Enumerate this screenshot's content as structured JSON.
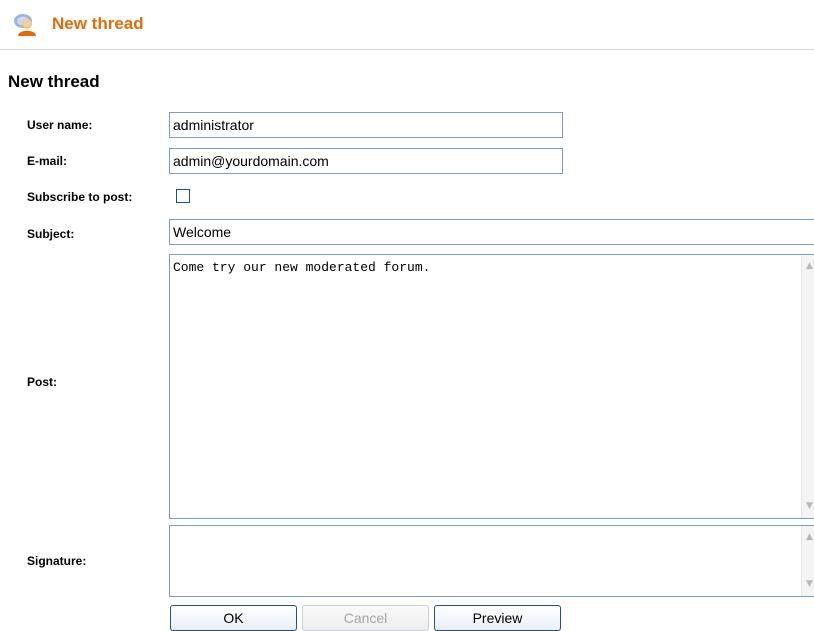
{
  "header": {
    "title": "New thread",
    "icon": "forum-user-icon"
  },
  "form": {
    "heading": "New thread",
    "fields": {
      "username": {
        "label": "User name:",
        "value": "administrator"
      },
      "email": {
        "label": "E-mail:",
        "value": "admin@yourdomain.com"
      },
      "subscribe": {
        "label": "Subscribe to post:",
        "checked": false
      },
      "subject": {
        "label": "Subject:",
        "value": "Welcome"
      },
      "post": {
        "label": "Post:",
        "value": "Come try our new moderated forum."
      },
      "signature": {
        "label": "Signature:",
        "value": ""
      }
    },
    "buttons": {
      "ok": "OK",
      "cancel": "Cancel",
      "preview": "Preview"
    }
  },
  "colors": {
    "accent": "#e36c0a",
    "input_border": "#7f9db9",
    "button_border": "#2a4f7a"
  }
}
